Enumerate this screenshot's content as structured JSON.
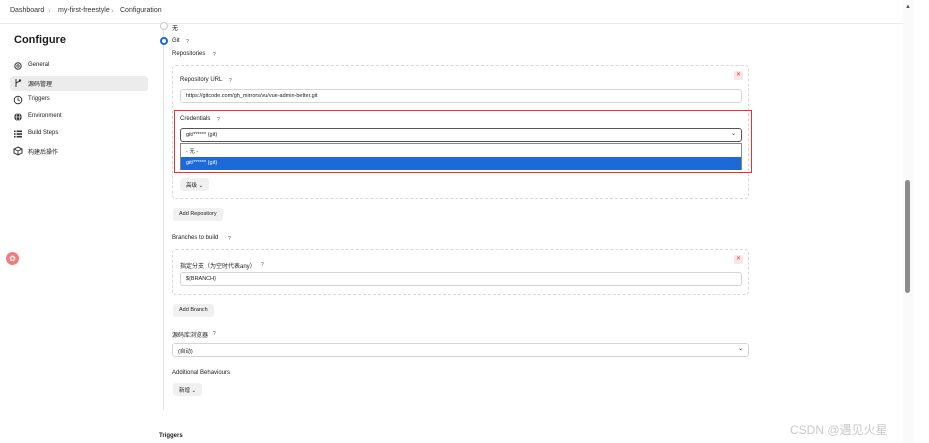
{
  "breadcrumb": [
    "Dashboard",
    "my-first-freestyle",
    "Configuration"
  ],
  "sidebar": {
    "title": "Configure",
    "items": [
      {
        "label": "General",
        "icon": "gear-icon"
      },
      {
        "label": "源码管理",
        "icon": "branch-icon",
        "active": true
      },
      {
        "label": "Triggers",
        "icon": "clock-icon"
      },
      {
        "label": "Environment",
        "icon": "globe-icon"
      },
      {
        "label": "Build Steps",
        "icon": "list-icon"
      },
      {
        "label": "构建后操作",
        "icon": "package-icon"
      }
    ]
  },
  "scm": {
    "option_none": "无",
    "option_git": "Git",
    "help": "?",
    "repositories_label": "Repositories",
    "repo_url_label": "Repository URL",
    "repo_url_value": "https://gitcode.com/gh_mirrors/vu/vue-admin-better.git",
    "credentials_label": "Credentials",
    "credentials_value": "git/****** (git)",
    "credentials_options": [
      "- 无 -",
      "git/****** (git)"
    ],
    "advanced_button": "高级",
    "add_repository_button": "Add Repository",
    "branches_label": "Branches to build",
    "branch_specifier_label": "指定分支（为空时代表any）",
    "branch_specifier_value": "${BRANCH}",
    "add_branch_button": "Add Branch",
    "repo_browser_label": "源码库浏览器",
    "repo_browser_value": "(自动)",
    "additional_behaviours_label": "Additional Behaviours",
    "add_behaviour_button": "新增"
  },
  "next_section_title": "Triggers",
  "watermark": "CSDN @遇见火星",
  "colors": {
    "accent": "#1c6ad7",
    "highlight": "#e0352b"
  }
}
